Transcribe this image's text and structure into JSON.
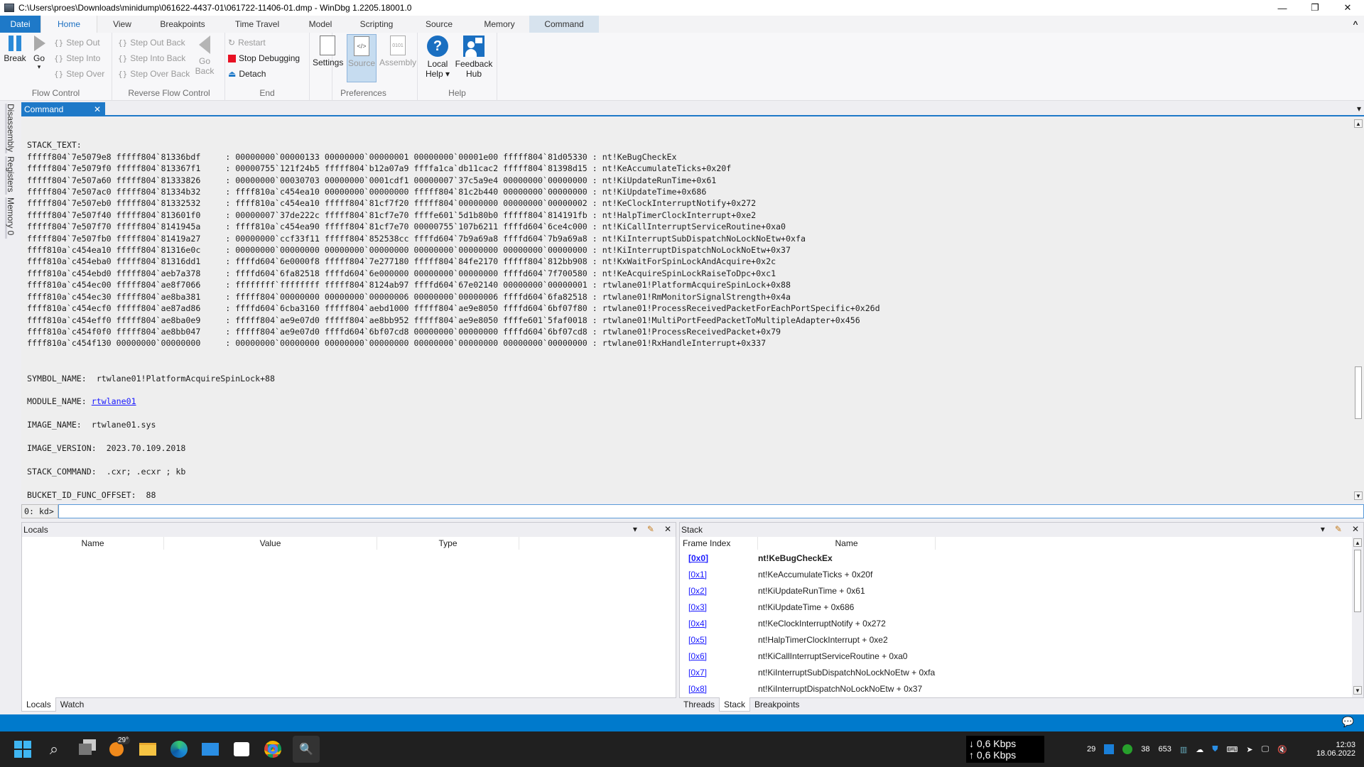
{
  "window": {
    "title": "C:\\Users\\proes\\Downloads\\minidump\\061622-4437-01\\061722-11406-01.dmp - WinDbg 1.2205.18001.0",
    "controls": {
      "minimize": "—",
      "restore": "❐",
      "close": "✕"
    }
  },
  "ribbon_tabs": [
    {
      "label": "Datei"
    },
    {
      "label": "Home"
    },
    {
      "label": "View"
    },
    {
      "label": "Breakpoints"
    },
    {
      "label": "Time Travel"
    },
    {
      "label": "Model"
    },
    {
      "label": "Scripting"
    },
    {
      "label": "Source"
    },
    {
      "label": "Memory"
    },
    {
      "label": "Command"
    }
  ],
  "ribbon_collapse": "^",
  "ribbon": {
    "flow_control": {
      "label": "Flow Control",
      "break": "Break",
      "go": "Go",
      "go_arrow": "▾",
      "step_out": "Step Out",
      "step_into": "Step Into",
      "step_over": "Step Over"
    },
    "reverse_flow_control": {
      "label": "Reverse Flow Control",
      "step_out_back": "Step Out Back",
      "step_into_back": "Step Into Back",
      "step_over_back": "Step Over Back",
      "go_back_1": "Go",
      "go_back_2": "Back"
    },
    "end": {
      "label": "End",
      "restart": "Restart",
      "stop_debugging": "Stop Debugging",
      "detach": "Detach"
    },
    "preferences": {
      "label": "Preferences",
      "settings": "Settings",
      "source": "Source",
      "assembly": "Assembly"
    },
    "help": {
      "label": "Help",
      "local_help_1": "Local",
      "local_help_2": "Help ▾",
      "feedback_hub_1": "Feedback",
      "feedback_hub_2": "Hub"
    }
  },
  "side_tabs": [
    "Disassembly",
    "Registers",
    "Memory 0"
  ],
  "command_window": {
    "tab_label": "Command",
    "close": "✕",
    "menu": "▾",
    "stack_text_header": "STACK_TEXT:",
    "stack_text": [
      {
        "child_sp": "fffff804`7e5079e8",
        "ret_addr": "fffff804`81336bdf",
        "args": "00000000`00000133 00000000`00000001 00000000`00001e00 fffff804`81d05330",
        "call_site": "nt!KeBugCheckEx"
      },
      {
        "child_sp": "fffff804`7e5079f0",
        "ret_addr": "fffff804`813367f1",
        "args": "00000755`121f24b5 fffff804`b12a07a9 ffffa1ca`db11cac2 fffff804`81398d15",
        "call_site": "nt!KeAccumulateTicks+0x20f"
      },
      {
        "child_sp": "fffff804`7e507a60",
        "ret_addr": "fffff804`81333826",
        "args": "00000000`00030703 00000000`0001cdf1 00000007`37c5a9e4 00000000`00000000",
        "call_site": "nt!KiUpdateRunTime+0x61"
      },
      {
        "child_sp": "fffff804`7e507ac0",
        "ret_addr": "fffff804`81334b32",
        "args": "ffff810a`c454ea10 00000000`00000000 fffff804`81c2b440 00000000`00000000",
        "call_site": "nt!KiUpdateTime+0x686"
      },
      {
        "child_sp": "fffff804`7e507eb0",
        "ret_addr": "fffff804`81332532",
        "args": "ffff810a`c454ea10 fffff804`81cf7f20 fffff804`00000000 00000000`00000002",
        "call_site": "nt!KeClockInterruptNotify+0x272"
      },
      {
        "child_sp": "fffff804`7e507f40",
        "ret_addr": "fffff804`813601f0",
        "args": "00000007`37de222c fffff804`81cf7e70 ffffe601`5d1b80b0 fffff804`814191fb",
        "call_site": "nt!HalpTimerClockInterrupt+0xe2"
      },
      {
        "child_sp": "fffff804`7e507f70",
        "ret_addr": "fffff804`8141945a",
        "args": "ffff810a`c454ea90 fffff804`81cf7e70 00000755`107b6211 ffffd604`6ce4c000",
        "call_site": "nt!KiCallInterruptServiceRoutine+0xa0"
      },
      {
        "child_sp": "fffff804`7e507fb0",
        "ret_addr": "fffff804`81419a27",
        "args": "00000000`ccf33f11 fffff804`852538cc ffffd604`7b9a69a8 ffffd604`7b9a69a8",
        "call_site": "nt!KiInterruptSubDispatchNoLockNoEtw+0xfa"
      },
      {
        "child_sp": "ffff810a`c454ea10",
        "ret_addr": "fffff804`81316e0c",
        "args": "00000000`00000000 00000000`00000000 00000000`00000000 00000000`00000000",
        "call_site": "nt!KiInterruptDispatchNoLockNoEtw+0x37"
      },
      {
        "child_sp": "ffff810a`c454eba0",
        "ret_addr": "fffff804`81316dd1",
        "args": "ffffd604`6e0000f8 fffff804`7e277180 fffff804`84fe2170 fffff804`812bb908",
        "call_site": "nt!KxWaitForSpinLockAndAcquire+0x2c"
      },
      {
        "child_sp": "ffff810a`c454ebd0",
        "ret_addr": "fffff804`aeb7a378",
        "args": "ffffd604`6fa82518 ffffd604`6e000000 00000000`00000000 ffffd604`7f700580",
        "call_site": "nt!KeAcquireSpinLockRaiseToDpc+0xc1"
      },
      {
        "child_sp": "ffff810a`c454ec00",
        "ret_addr": "fffff804`ae8f7066",
        "args": "ffffffff`ffffffff fffff804`8124ab97 ffffd604`67e02140 00000000`00000001",
        "call_site": "rtwlane01!PlatformAcquireSpinLock+0x88"
      },
      {
        "child_sp": "ffff810a`c454ec30",
        "ret_addr": "fffff804`ae8ba381",
        "args": "fffff804`00000000 00000000`00000006 00000000`00000006 ffffd604`6fa82518",
        "call_site": "rtwlane01!RmMonitorSignalStrength+0x4a"
      },
      {
        "child_sp": "ffff810a`c454ecf0",
        "ret_addr": "fffff804`ae87ad86",
        "args": "ffffd604`6cba3160 fffff804`aebd1000 fffff804`ae9e8050 ffffd604`6bf07f80",
        "call_site": "rtwlane01!ProcessReceivedPacketForEachPortSpecific+0x26d"
      },
      {
        "child_sp": "ffff810a`c454eff0",
        "ret_addr": "fffff804`ae8ba0e9",
        "args": "fffff804`ae9e07d0 fffff804`ae8bb952 fffff804`ae9e8050 ffffe601`5faf0018",
        "call_site": "rtwlane01!MultiPortFeedPacketToMultipleAdapter+0x456"
      },
      {
        "child_sp": "ffff810a`c454f0f0",
        "ret_addr": "fffff804`ae8bb047",
        "args": "fffff804`ae9e07d0 ffffd604`6bf07cd8 00000000`00000000 ffffd604`6bf07cd8",
        "call_site": "rtwlane01!ProcessReceivedPacket+0x79"
      },
      {
        "child_sp": "ffff810a`c454f130",
        "ret_addr": "00000000`00000000",
        "args": "00000000`00000000 00000000`00000000 00000000`00000000 00000000`00000000",
        "call_site": "rtwlane01!RxHandleInterrupt+0x337"
      }
    ],
    "fields": {
      "symbol_name_key": "SYMBOL_NAME:  ",
      "symbol_name_val": "rtwlane01!PlatformAcquireSpinLock+88",
      "module_name_key": "MODULE_NAME: ",
      "module_name_val": "rtwlane01",
      "image_name_key": "IMAGE_NAME:  ",
      "image_name_val": "rtwlane01.sys",
      "image_version_key": "IMAGE_VERSION:  ",
      "image_version_val": "2023.70.109.2018",
      "stack_command_key": "STACK_COMMAND:  ",
      "stack_command_val": ".cxr; .ecxr ; kb",
      "bucket_key": "BUCKET_ID_FUNC_OFFSET:  ",
      "bucket_val": "88"
    },
    "prompt": "0: kd>",
    "input_value": ""
  },
  "locals_pane": {
    "title": "Locals",
    "columns": [
      "Name",
      "Value",
      "Type"
    ],
    "tabs": [
      "Locals",
      "Watch"
    ],
    "icons": {
      "menu": "▾",
      "pin": "📌",
      "close": "✕"
    }
  },
  "stack_pane": {
    "title": "Stack",
    "columns": [
      "Frame Index",
      "Name"
    ],
    "frames": [
      {
        "index": "[0x0]",
        "name": "nt!KeBugCheckEx"
      },
      {
        "index": "[0x1]",
        "name": "nt!KeAccumulateTicks + 0x20f"
      },
      {
        "index": "[0x2]",
        "name": "nt!KiUpdateRunTime + 0x61"
      },
      {
        "index": "[0x3]",
        "name": "nt!KiUpdateTime + 0x686"
      },
      {
        "index": "[0x4]",
        "name": "nt!KeClockInterruptNotify + 0x272"
      },
      {
        "index": "[0x5]",
        "name": "nt!HalpTimerClockInterrupt + 0xe2"
      },
      {
        "index": "[0x6]",
        "name": "nt!KiCallInterruptServiceRoutine + 0xa0"
      },
      {
        "index": "[0x7]",
        "name": "nt!KiInterruptSubDispatchNoLockNoEtw + 0xfa"
      },
      {
        "index": "[0x8]",
        "name": "nt!KiInterruptDispatchNoLockNoEtw + 0x37"
      }
    ],
    "tabs": [
      "Threads",
      "Stack",
      "Breakpoints"
    ],
    "icons": {
      "menu": "▾",
      "pin": "📌",
      "close": "✕"
    }
  },
  "statusbar": {
    "notification_icon": "💬"
  },
  "taskbar": {
    "weather_temp": "29°",
    "net_down": "↓ 0,6 Kbps",
    "net_up": "↑ 0,6 Kbps",
    "tray_num1": "29",
    "tray_num2": "38",
    "tray_num3": "653",
    "time": "12:03",
    "date": "18.06.2022"
  }
}
